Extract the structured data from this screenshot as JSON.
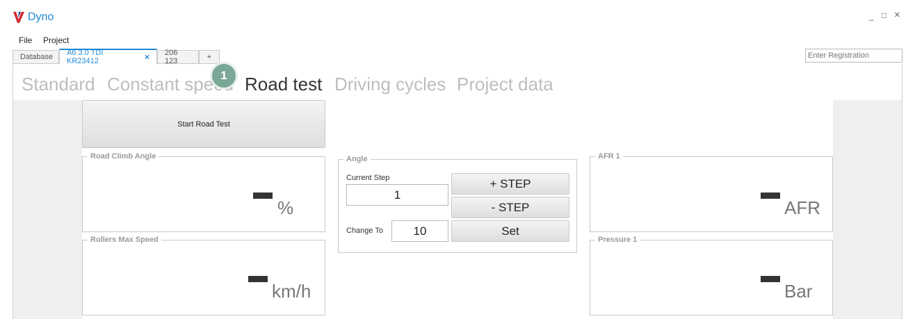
{
  "window": {
    "title": "Dyno",
    "controls": {
      "minimize": "_",
      "maximize": "□",
      "close": "×"
    }
  },
  "menu": {
    "items": [
      "File",
      "Project"
    ]
  },
  "tabs": {
    "items": [
      {
        "label": "Database"
      },
      {
        "label": "A6 3.0 TDI KR23412",
        "close": "×"
      },
      {
        "label": "206 123"
      },
      {
        "label": "+"
      }
    ],
    "registration_placeholder": "Enter Registration"
  },
  "nav": {
    "items": [
      "Standard",
      "Constant speed",
      "Road test",
      "Driving cycles",
      "Project data"
    ],
    "badge": "1"
  },
  "start_button": "Start Road Test",
  "gauges": {
    "road_climb": {
      "title": "Road Climb Angle",
      "unit": "%"
    },
    "rollers_speed": {
      "title": "Rollers Max Speed",
      "unit": "km/h"
    },
    "afr": {
      "title": "AFR 1",
      "unit": "AFR"
    },
    "pressure": {
      "title": "Pressure 1",
      "unit": "Bar"
    }
  },
  "angle": {
    "title": "Angle",
    "current_step_label": "Current Step",
    "current_step_value": "1",
    "change_to_label": "Change To",
    "change_to_value": "10",
    "plus_step": "+ STEP",
    "minus_step": "- STEP",
    "set": "Set"
  },
  "colors": {
    "accent": "#1e88d6",
    "badge": "#7aa796",
    "logo_red": "#d0282e"
  }
}
